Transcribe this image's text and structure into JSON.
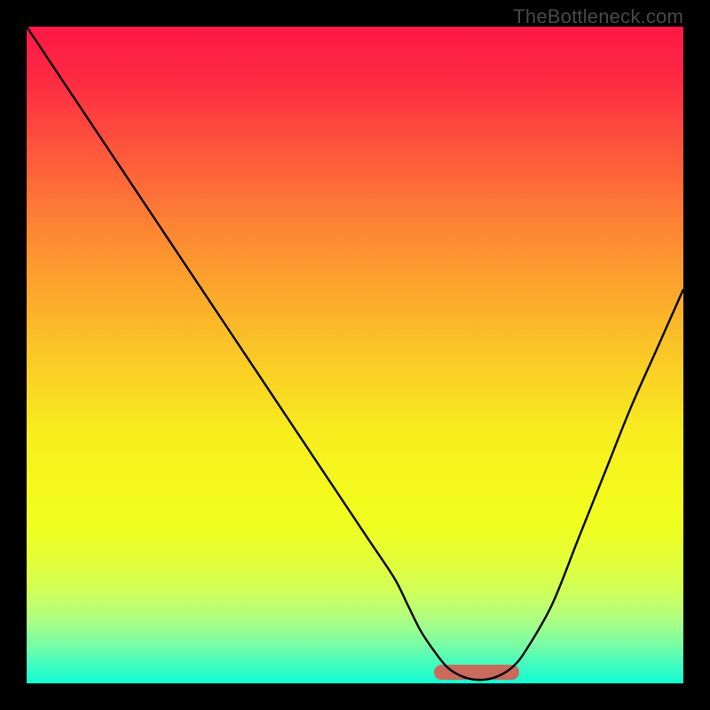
{
  "watermark": "TheBottleneck.com",
  "colors": {
    "frame": "#000000",
    "curve": "#000000",
    "band": "#c96a5d"
  },
  "chart_data": {
    "type": "line",
    "title": "",
    "xlabel": "",
    "ylabel": "",
    "xlim": [
      0,
      100
    ],
    "ylim": [
      0,
      100
    ],
    "grid": false,
    "gradient_stops": [
      {
        "pos": 0.0,
        "color": "#fe1846"
      },
      {
        "pos": 0.08,
        "color": "#fe2a43"
      },
      {
        "pos": 0.2,
        "color": "#fd5b3b"
      },
      {
        "pos": 0.35,
        "color": "#fc9530"
      },
      {
        "pos": 0.5,
        "color": "#fac826"
      },
      {
        "pos": 0.62,
        "color": "#f7ed1e"
      },
      {
        "pos": 0.72,
        "color": "#f3fb1c"
      },
      {
        "pos": 0.77,
        "color": "#edfe24"
      },
      {
        "pos": 0.82,
        "color": "#e0fe3d"
      },
      {
        "pos": 0.86,
        "color": "#cfff59"
      },
      {
        "pos": 0.9,
        "color": "#b1fe80"
      },
      {
        "pos": 0.94,
        "color": "#7afda4"
      },
      {
        "pos": 0.97,
        "color": "#44fcbe"
      },
      {
        "pos": 1.0,
        "color": "#12fbd2"
      }
    ],
    "series": [
      {
        "name": "bottleneck-curve",
        "x": [
          0,
          4,
          8,
          12,
          16,
          20,
          24,
          28,
          32,
          36,
          40,
          44,
          48,
          52,
          56,
          58,
          60,
          62,
          64,
          66,
          68,
          70,
          72,
          74,
          76,
          80,
          84,
          88,
          92,
          96,
          100
        ],
        "y": [
          100,
          94,
          88,
          82,
          76,
          70,
          64,
          58,
          52,
          46,
          40,
          34,
          28,
          22,
          16,
          12,
          8,
          5,
          2.5,
          1.2,
          0.6,
          0.6,
          1.2,
          2.5,
          5,
          12,
          22,
          32,
          42,
          51,
          60
        ]
      }
    ],
    "bottleneck_band": {
      "x_start": 62,
      "x_end": 75,
      "y": 1.7,
      "thickness": 2.4
    },
    "legend": false
  }
}
